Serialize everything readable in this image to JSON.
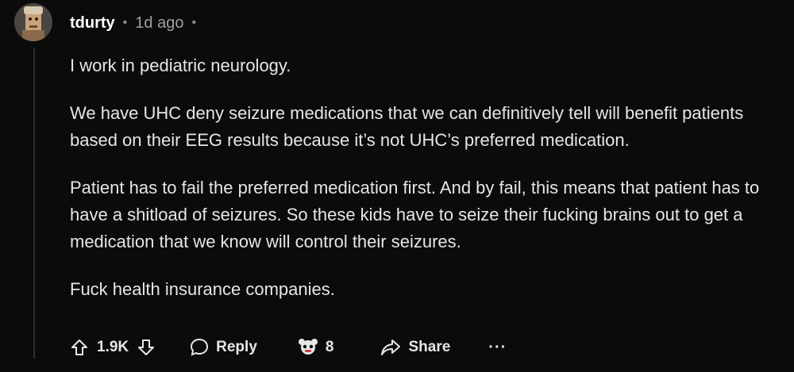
{
  "comment": {
    "username": "tdurty",
    "separator": "•",
    "time": "1d ago",
    "paragraphs": [
      "I work in pediatric neurology.",
      "We have UHC deny seizure medications that we can definitively tell will benefit patients based on their EEG results because it’s not UHC’s preferred medication.",
      "Patient has to fail the preferred medication first. And by fail, this means that patient has to have a shitload of seizures. So these kids have to seize their fucking brains out to get a medication that we know will control their seizures.",
      "Fuck health insurance companies."
    ]
  },
  "actions": {
    "vote_count": "1.9K",
    "reply_label": "Reply",
    "award_count": "8",
    "share_label": "Share",
    "more_label": "···"
  },
  "icons": {
    "upvote": "upvote-icon",
    "downvote": "downvote-icon",
    "reply": "speech-bubble-icon",
    "award": "award-icon",
    "share": "share-arrow-icon"
  },
  "colors": {
    "background": "#0b0b0b",
    "text": "#e4e6e8",
    "muted": "#9aa0a6"
  }
}
